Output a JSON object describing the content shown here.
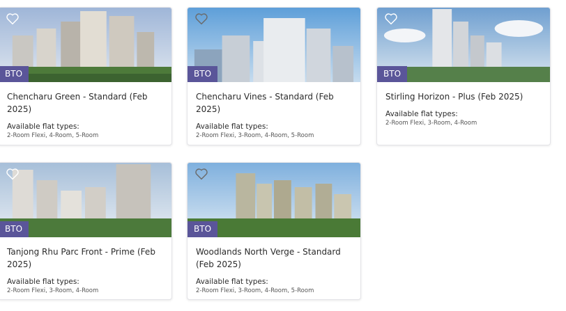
{
  "listings": [
    {
      "badge": "BTO",
      "title": "Chencharu Green - Standard (Feb 2025)",
      "types_label": "Available flat types:",
      "flat_types": "2-Room Flexi, 4-Room, 5-Room"
    },
    {
      "badge": "BTO",
      "title": "Chencharu Vines - Standard (Feb 2025)",
      "types_label": "Available flat types:",
      "flat_types": "2-Room Flexi, 3-Room, 4-Room, 5-Room"
    },
    {
      "badge": "BTO",
      "title": "Stirling Horizon - Plus (Feb 2025)",
      "types_label": "Available flat types:",
      "flat_types": "2-Room Flexi, 3-Room, 4-Room"
    },
    {
      "badge": "BTO",
      "title": "Tanjong Rhu Parc Front - Prime (Feb 2025)",
      "types_label": "Available flat types:",
      "flat_types": "2-Room Flexi, 3-Room, 4-Room"
    },
    {
      "badge": "BTO",
      "title": "Woodlands North Verge - Standard (Feb 2025)",
      "types_label": "Available flat types:",
      "flat_types": "2-Room Flexi, 3-Room, 4-Room, 5-Room"
    }
  ],
  "icons": {
    "favourite": "heart-outline-icon"
  },
  "colors": {
    "badge": "#5a5599",
    "title_text": "#2b2b2b",
    "secondary_text": "#555555"
  }
}
